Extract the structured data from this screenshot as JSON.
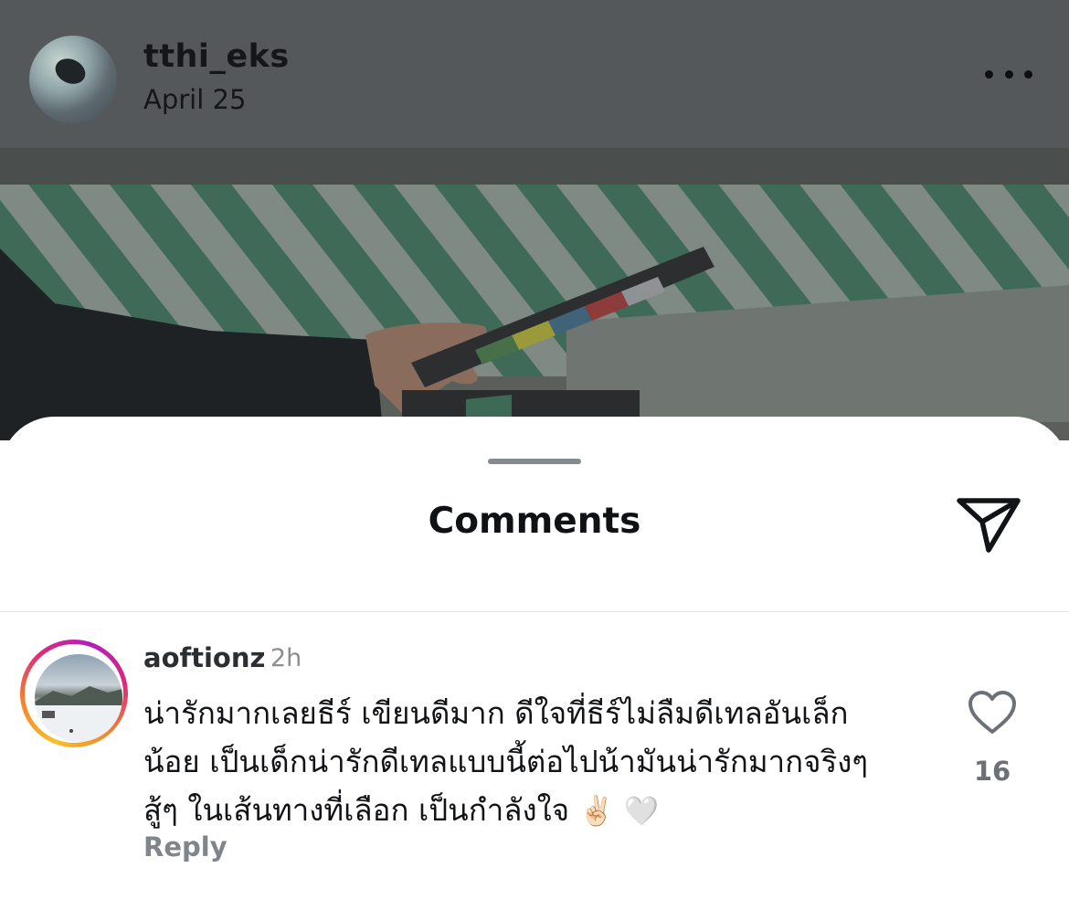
{
  "post": {
    "username": "tthi_eks",
    "date": "April 25"
  },
  "sheet": {
    "title": "Comments"
  },
  "comment": {
    "username": "aoftionz",
    "time": "2h",
    "lines": [
      "น่ารักมากเลยธีร์ เขียนดีมาก ดีใจที่ธีร์ไม่ลืมดีเทลอันเล็ก",
      "น้อย เป็นเด็กน่ารักดีเทลแบบนี้ต่อไปน้ามันน่ารักมากจริงๆ",
      "สู้ๆ ในเส้นทางที่เลือก เป็นกำลังใจ"
    ],
    "emoji_peace": "✌🏻",
    "emoji_heart": "🤍",
    "reply_label": "Reply",
    "like_count": "16"
  },
  "icons": {
    "more": "more-options-icon",
    "send": "send-icon",
    "like": "heart-outline-icon"
  }
}
